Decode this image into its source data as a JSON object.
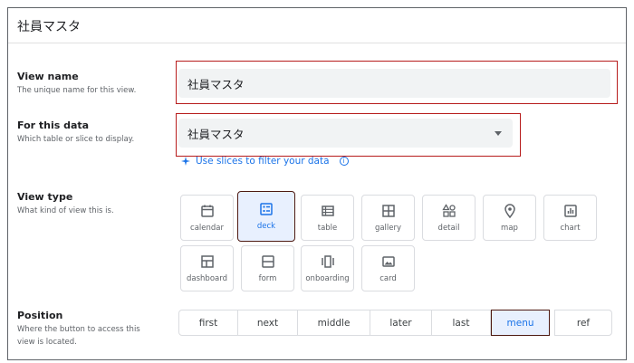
{
  "header": {
    "title": "社員マスタ"
  },
  "view_name": {
    "label": "View name",
    "description": "The unique name for this view.",
    "value": "社員マスタ"
  },
  "for_this_data": {
    "label": "For this data",
    "description": "Which table or slice to display.",
    "value": "社員マスタ",
    "slice_link": "Use slices to filter your data",
    "info_glyph": "i"
  },
  "view_type": {
    "label": "View type",
    "description": "What kind of view this is.",
    "selected": "deck",
    "options": [
      {
        "label": "calendar",
        "icon": "calendar-icon"
      },
      {
        "label": "deck",
        "icon": "deck-icon"
      },
      {
        "label": "table",
        "icon": "table-icon"
      },
      {
        "label": "gallery",
        "icon": "gallery-icon"
      },
      {
        "label": "detail",
        "icon": "detail-icon"
      },
      {
        "label": "map",
        "icon": "map-pin-icon"
      },
      {
        "label": "chart",
        "icon": "chart-icon"
      },
      {
        "label": "dashboard",
        "icon": "dashboard-icon"
      },
      {
        "label": "form",
        "icon": "form-icon"
      },
      {
        "label": "onboarding",
        "icon": "onboarding-icon"
      },
      {
        "label": "card",
        "icon": "card-icon"
      }
    ]
  },
  "position": {
    "label": "Position",
    "description_line1": "Where the button to access this",
    "description_line2": "view is located.",
    "selected": "menu",
    "options": [
      "first",
      "next",
      "middle",
      "later",
      "last",
      "menu",
      "ref"
    ]
  },
  "colors": {
    "accent": "#1a73e8",
    "selected_bg": "#e8f0fe",
    "highlight_outline": "#b71c1c",
    "field_bg": "#f1f3f4"
  }
}
